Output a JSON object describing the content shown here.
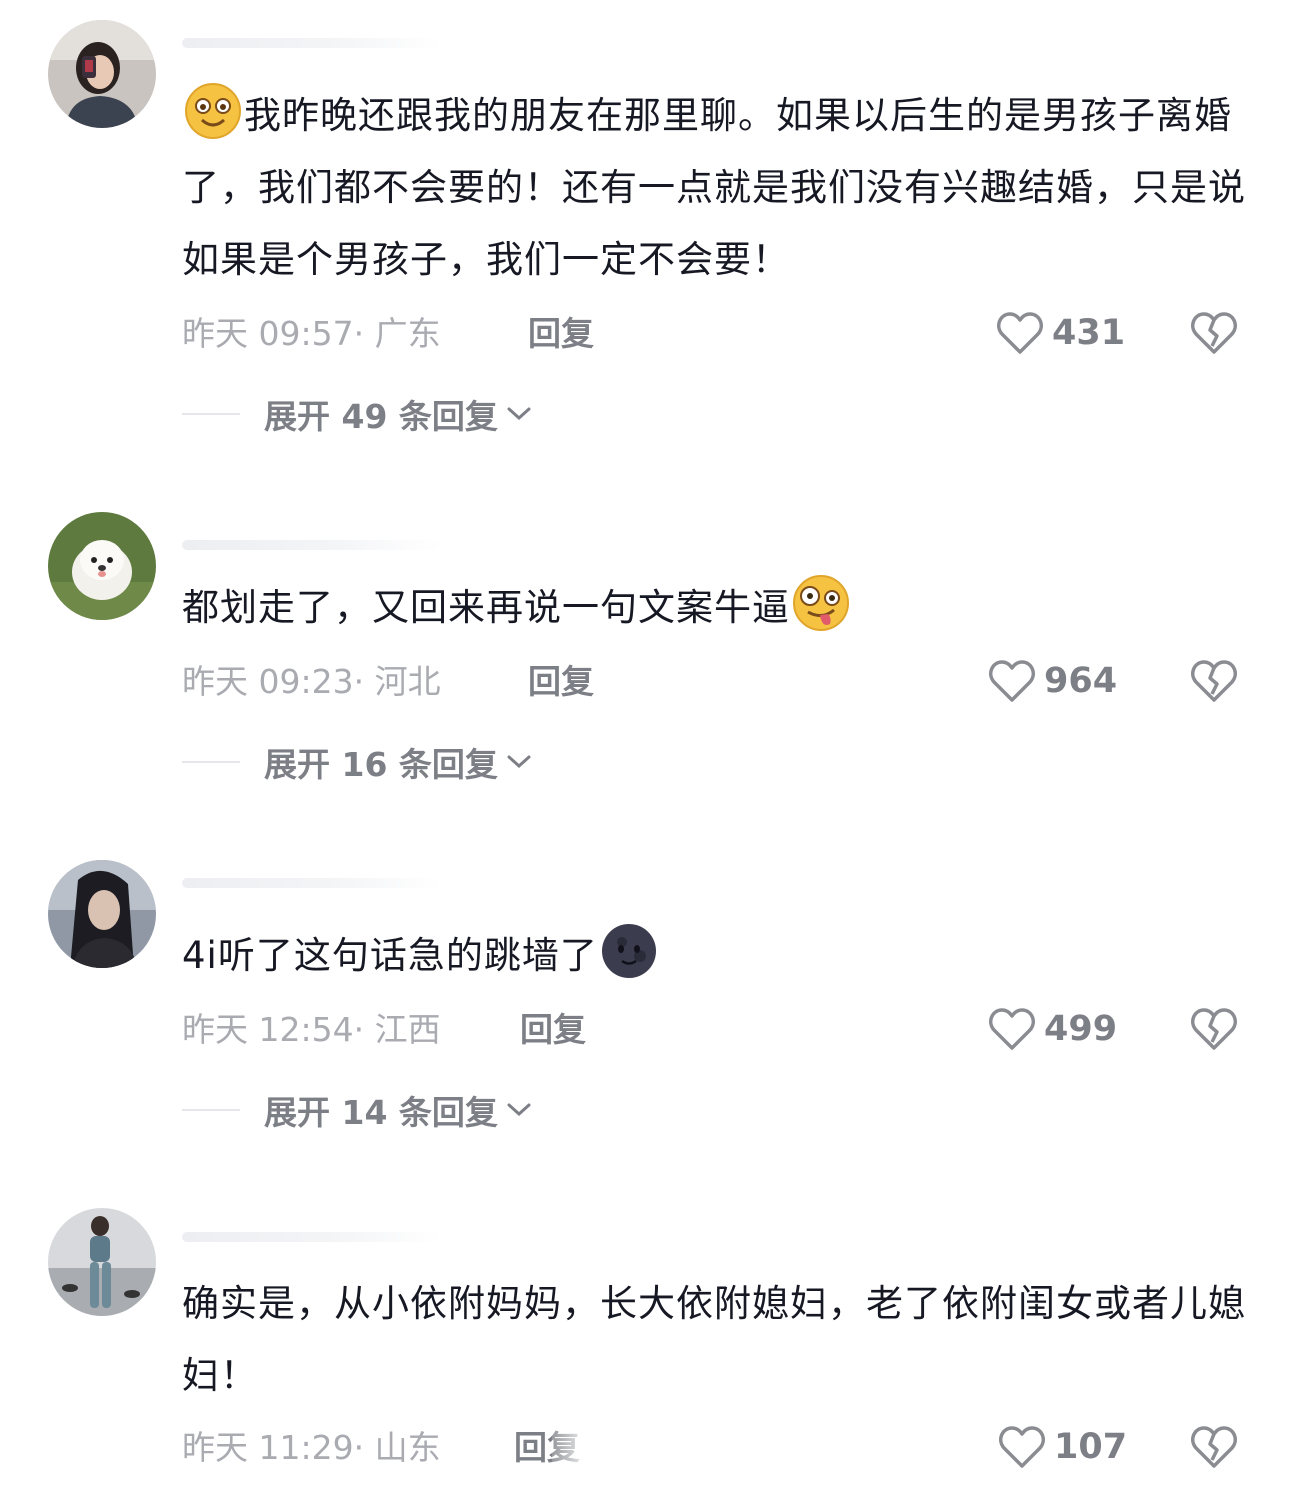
{
  "comments": [
    {
      "avatar": "avatar-woman-mirror-selfie",
      "emoji_lead": "flushed-smile-emoji",
      "text": "我昨晚还跟我的朋友在那里聊。如果以后生的是男孩子离婚了，我们都不会要的！还有一点就是我们没有兴趣结婚，只是说如果是个男孩子，我们一定不会要！",
      "time": "昨天 09:57· 广东",
      "reply_label": "回复",
      "likes": "431",
      "expand_label": "展开 49 条回复"
    },
    {
      "avatar": "avatar-white-puppy",
      "text": "都划走了，又回来再说一句文案牛逼",
      "emoji_trail": "zany-face-emoji",
      "time": "昨天 09:23· 河北",
      "reply_label": "回复",
      "likes": "964",
      "expand_label": "展开 16 条回复"
    },
    {
      "avatar": "avatar-woman-portrait",
      "text": "4i听了这句话急的跳墙了",
      "emoji_trail": "new-moon-face-emoji",
      "time": "昨天 12:54· 江西",
      "reply_label": "回复",
      "likes": "499",
      "expand_label": "展开 14 条回复"
    },
    {
      "avatar": "avatar-woman-gym",
      "text": "确实是，从小依附妈妈，长大依附媳妇，老了依附闺女或者儿媳妇！",
      "time": "昨天 11:29· 山东",
      "reply_label": "回复",
      "likes": "107"
    }
  ],
  "icons": {
    "like": "heart-outline-icon",
    "dislike": "broken-heart-icon",
    "expand": "chevron-down-icon"
  },
  "colors": {
    "text": "#161823",
    "meta": "#a9abb1",
    "secondary": "#7d7f86"
  }
}
